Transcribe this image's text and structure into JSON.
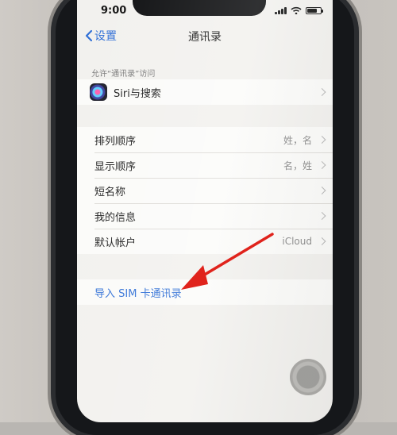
{
  "status_bar": {
    "time": "9:00",
    "battery_level": 0.75
  },
  "nav": {
    "back_label": "设置",
    "title": "通讯录"
  },
  "access_section": {
    "header": "允许“通讯录”访问",
    "items": [
      {
        "label": "Siri与搜索",
        "icon": "siri-icon"
      }
    ]
  },
  "settings_section": {
    "items": [
      {
        "label": "排列顺序",
        "value": "姓，名"
      },
      {
        "label": "显示顺序",
        "value": "名，姓"
      },
      {
        "label": "短名称",
        "value": ""
      },
      {
        "label": "我的信息",
        "value": ""
      },
      {
        "label": "默认帐户",
        "value": "iCloud"
      }
    ]
  },
  "import_section": {
    "label": "导入 SIM 卡通讯录"
  },
  "colors": {
    "link": "#2f6fd6",
    "annotation_arrow": "#e0231c"
  }
}
